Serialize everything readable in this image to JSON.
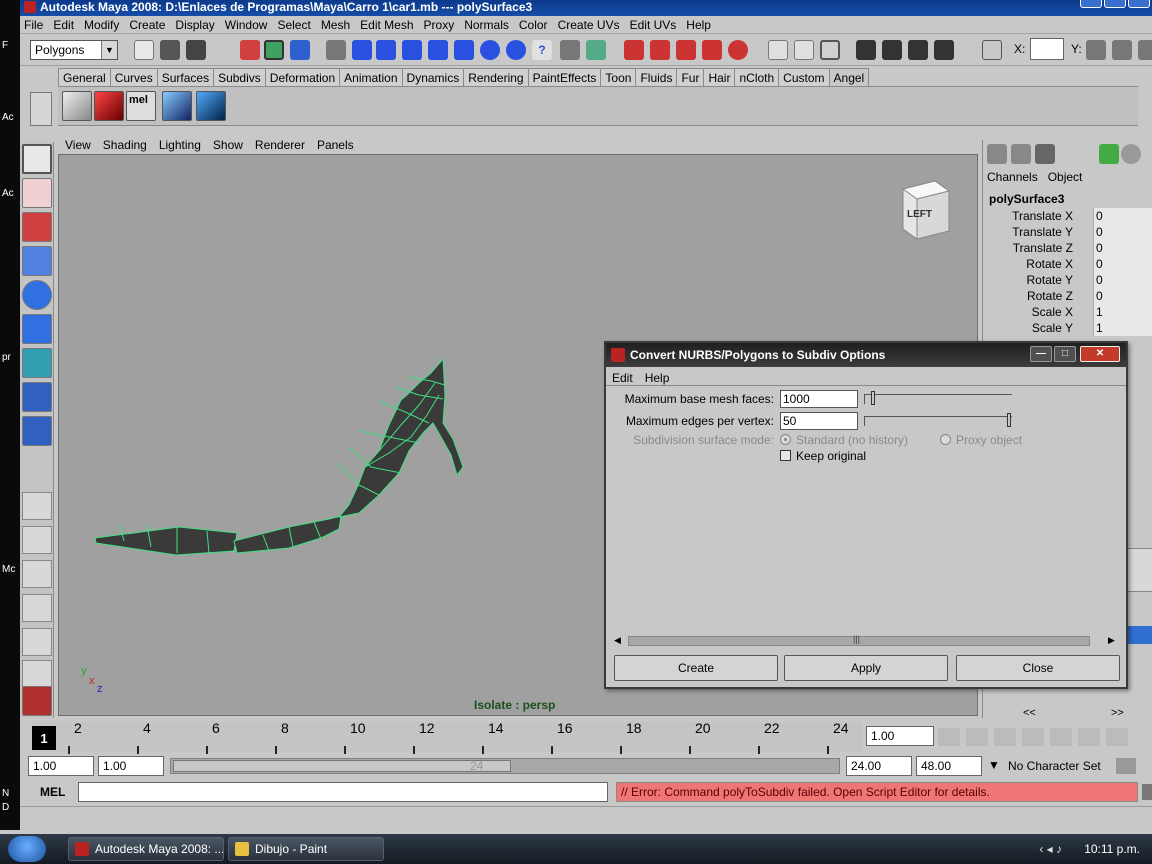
{
  "window": {
    "title": "Autodesk Maya 2008: D:\\Enlaces de Programas\\Maya\\Carro 1\\car1.mb  ---  polySurface3"
  },
  "desktop_labels": [
    "F",
    "Ac",
    "Ac",
    "pr",
    "Mc",
    "N",
    "D"
  ],
  "menubar": [
    "File",
    "Edit",
    "Modify",
    "Create",
    "Display",
    "Window",
    "Select",
    "Mesh",
    "Edit Mesh",
    "Proxy",
    "Normals",
    "Color",
    "Create UVs",
    "Edit UVs",
    "Help"
  ],
  "statusline": {
    "mode": "Polygons",
    "x_label": "X:",
    "y_label": "Y:"
  },
  "shelf_tabs": [
    "General",
    "Curves",
    "Surfaces",
    "Subdivs",
    "Deformation",
    "Animation",
    "Dynamics",
    "Rendering",
    "PaintEffects",
    "Toon",
    "Fluids",
    "Fur",
    "Hair",
    "nCloth",
    "Custom",
    "Angel"
  ],
  "shelf_active_tab": "Angel",
  "shelf_icons": [
    "car-icon",
    "car-red-icon",
    "mel-script-icon",
    "blue-plane-icon",
    "blue-cube-icon"
  ],
  "shelf_mel_label": "mel",
  "panel_menu": [
    "View",
    "Shading",
    "Lighting",
    "Show",
    "Renderer",
    "Panels"
  ],
  "viewport": {
    "isolate_label": "Isolate : persp",
    "viewcube_label": "LEFT",
    "axis_labels": {
      "x": "x",
      "y": "y",
      "z": "z"
    },
    "mesh_color": "#3a3a3a",
    "wire_color": "#40e080"
  },
  "channel_box": {
    "menu": [
      "Channels",
      "Object"
    ],
    "object": "polySurface3",
    "rows": [
      {
        "label": "Translate X",
        "value": "0"
      },
      {
        "label": "Translate Y",
        "value": "0"
      },
      {
        "label": "Translate Z",
        "value": "0"
      },
      {
        "label": "Rotate X",
        "value": "0"
      },
      {
        "label": "Rotate Y",
        "value": "0"
      },
      {
        "label": "Rotate Z",
        "value": "0"
      },
      {
        "label": "Scale X",
        "value": "1"
      },
      {
        "label": "Scale Y",
        "value": "1"
      }
    ],
    "nav_left": "<<",
    "nav_right": ">>"
  },
  "dialog": {
    "title": "Convert NURBS/Polygons to Subdiv Options",
    "menu": [
      "Edit",
      "Help"
    ],
    "max_faces_label": "Maximum base mesh faces:",
    "max_faces_value": "1000",
    "max_faces_slider": 0.04,
    "max_edges_label": "Maximum edges per vertex:",
    "max_edges_value": "50",
    "max_edges_slider": 1.0,
    "mode_label": "Subdivision surface mode:",
    "mode_standard": "Standard (no history)",
    "mode_proxy": "Proxy object",
    "keep_original_label": "Keep original",
    "keep_original_checked": false,
    "buttons": {
      "create": "Create",
      "apply": "Apply",
      "close": "Close"
    },
    "scroll_handle": "|||"
  },
  "timeslider": {
    "current_frame": "1",
    "tick_labels": [
      "2",
      "4",
      "6",
      "8",
      "10",
      "12",
      "14",
      "16",
      "18",
      "20",
      "22",
      "24"
    ],
    "current_time": "1.00"
  },
  "range": {
    "start": "1.00",
    "anim_start": "1.00",
    "handle_label": "24",
    "end": "24.00",
    "anim_end": "48.00",
    "char_set": "No Character Set"
  },
  "cmdline": {
    "label": "MEL",
    "result": "// Error: Command polyToSubdiv failed. Open Script Editor for details."
  },
  "taskbar": {
    "tasks": [
      "Autodesk Maya 2008: ...",
      "Dibujo - Paint"
    ],
    "clock": "10:11 p.m."
  },
  "colors": {
    "error_bg": "#f07575",
    "viewport_bg": "#a0a0a0"
  }
}
